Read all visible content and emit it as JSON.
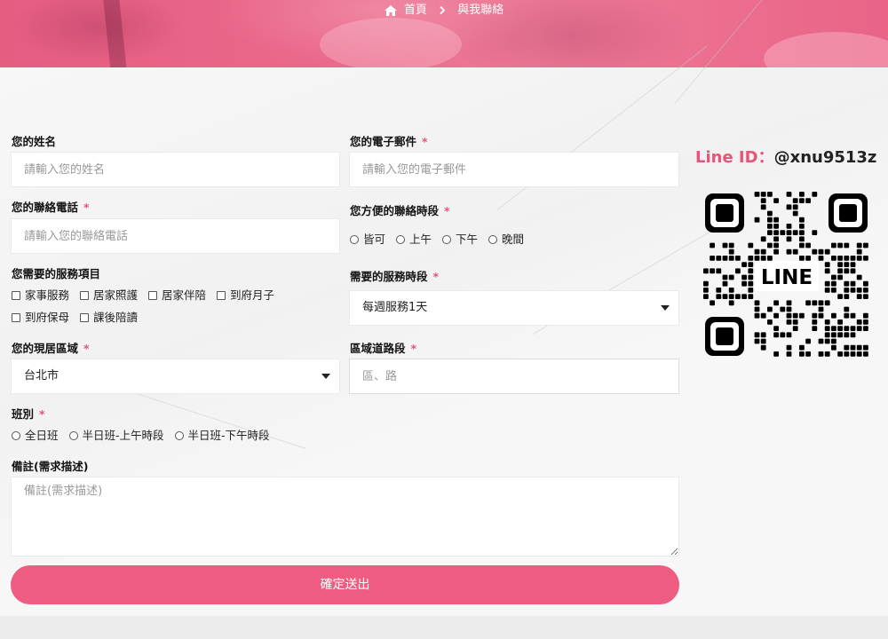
{
  "breadcrumb": {
    "home": "首頁",
    "current": "與我聯絡"
  },
  "form": {
    "name": {
      "label": "您的姓名",
      "placeholder": "請輸入您的姓名"
    },
    "email": {
      "label": "您的電子郵件",
      "placeholder": "請輸入您的電子郵件"
    },
    "phone": {
      "label": "您的聯絡電話",
      "placeholder": "請輸入您的聯絡電話"
    },
    "contact_time": {
      "label": "您方便的聯絡時段",
      "options": [
        "皆可",
        "上午",
        "下午",
        "晚間"
      ]
    },
    "services": {
      "label": "您需要的服務項目",
      "options": [
        "家事服務",
        "居家照護",
        "居家伴陪",
        "到府月子",
        "到府保母",
        "課後陪讀"
      ]
    },
    "service_period": {
      "label": "需要的服務時段",
      "value": "每週服務1天"
    },
    "region": {
      "label": "您的現居區域",
      "value": "台北市"
    },
    "road": {
      "label": "區域道路段",
      "placeholder": "區、路"
    },
    "shift": {
      "label": "班別",
      "options": [
        "全日班",
        "半日班-上午時段",
        "半日班-下午時段"
      ]
    },
    "notes": {
      "label": "備註(需求描述)",
      "placeholder": "備註(需求描述)"
    },
    "required_mark": "*",
    "submit_label": "確定送出"
  },
  "line": {
    "label": "Line ID：",
    "id": "@xnu9513z",
    "qr_text": "LINE"
  },
  "colors": {
    "accent": "#ef5c82",
    "accent_text": "#e8537a"
  }
}
